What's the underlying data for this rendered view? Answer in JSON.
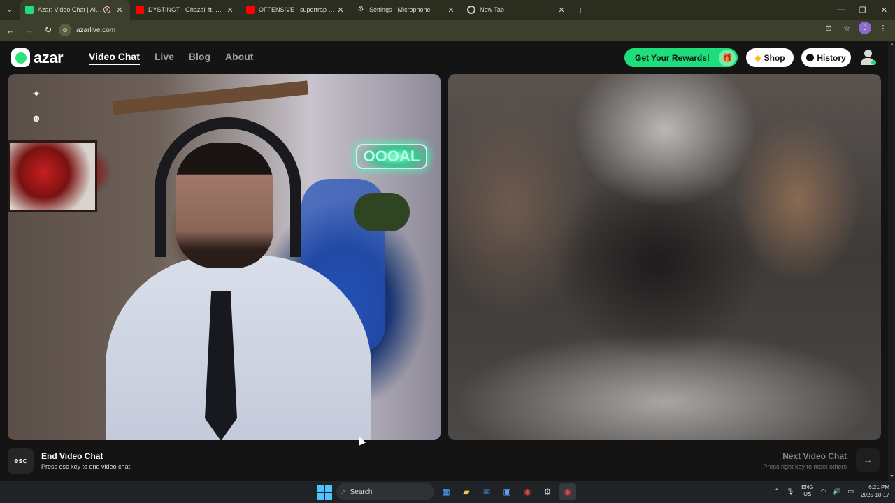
{
  "browser": {
    "tabs": [
      {
        "title": "Azar: Video Chat | Alternati",
        "active": true,
        "favicon_color": "#1dde7a",
        "recording": true
      },
      {
        "title": "DYSTINCT - Ghazali ft. Bryan M",
        "active": false,
        "favicon_color": "#ff0000"
      },
      {
        "title": "OFFENSIVE - supertrap type be",
        "active": false,
        "favicon_color": "#ff0000"
      },
      {
        "title": "Settings - Microphone",
        "active": false,
        "favicon": "gear-icon"
      },
      {
        "title": "New Tab",
        "active": false,
        "favicon": "chrome-icon"
      }
    ],
    "url": "azarlive.com",
    "profile_initial": "J"
  },
  "site": {
    "logo_text": "azar",
    "nav": [
      {
        "label": "Video Chat",
        "active": true
      },
      {
        "label": "Live",
        "active": false
      },
      {
        "label": "Blog",
        "active": false
      },
      {
        "label": "About",
        "active": false
      }
    ],
    "rewards_label": "Get Your Rewards!",
    "shop_label": "Shop",
    "history_label": "History",
    "neon_sign": "OOOAL"
  },
  "controls": {
    "esc_key": "esc",
    "end_title": "End Video Chat",
    "end_hint": "Press esc key to end video chat",
    "next_title": "Next Video Chat",
    "next_hint": "Press right key to meet others"
  },
  "taskbar": {
    "search_label": "Search",
    "lang_top": "ENG",
    "lang_bottom": "US",
    "time": "6:21 PM",
    "date": "2025-10-17"
  },
  "colors": {
    "accent": "#1dde7a",
    "background": "#141414"
  }
}
